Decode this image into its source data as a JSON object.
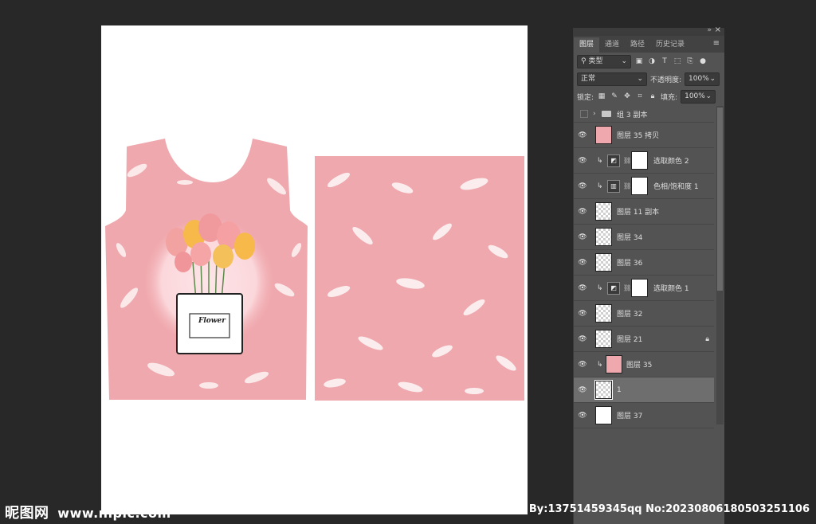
{
  "panel": {
    "tabs": [
      "图层",
      "通道",
      "路径",
      "历史记录"
    ],
    "filter_label": "类型",
    "blend_mode": "正常",
    "opacity_label": "不透明度:",
    "opacity_value": "100%",
    "lock_label": "锁定:",
    "fill_label": "填充:",
    "fill_value": "100%"
  },
  "layers": [
    {
      "name": "组 3 副本",
      "type": "group"
    },
    {
      "name": "图层 35 拷贝",
      "type": "pixel",
      "thumb": "pink"
    },
    {
      "name": "选取颜色 2",
      "type": "adjustment",
      "clip": true
    },
    {
      "name": "色相/饱和度 1",
      "type": "adjustment",
      "clip": true
    },
    {
      "name": "图层 11 副本",
      "type": "pixel"
    },
    {
      "name": "图层 34",
      "type": "pixel"
    },
    {
      "name": "图层 36",
      "type": "pixel"
    },
    {
      "name": "选取颜色 1",
      "type": "adjustment",
      "clip": true
    },
    {
      "name": "图层 32",
      "type": "pixel"
    },
    {
      "name": "图层 21",
      "type": "pixel",
      "locked": true
    },
    {
      "name": "图层 35",
      "type": "pixel",
      "clip": true,
      "thumb": "pink"
    },
    {
      "name": "1",
      "type": "pixel",
      "selected": true
    },
    {
      "name": "图层 37",
      "type": "pixel",
      "thumb": "white"
    }
  ],
  "artwork": {
    "vase_label": "Flower"
  },
  "watermark": {
    "site": "昵图网",
    "url": "www.nipic.com"
  },
  "footer": "By:13751459345qq No:20230806180503251106",
  "colors": {
    "pink": "#efa8ad",
    "panel": "#535353",
    "background": "#282828"
  }
}
